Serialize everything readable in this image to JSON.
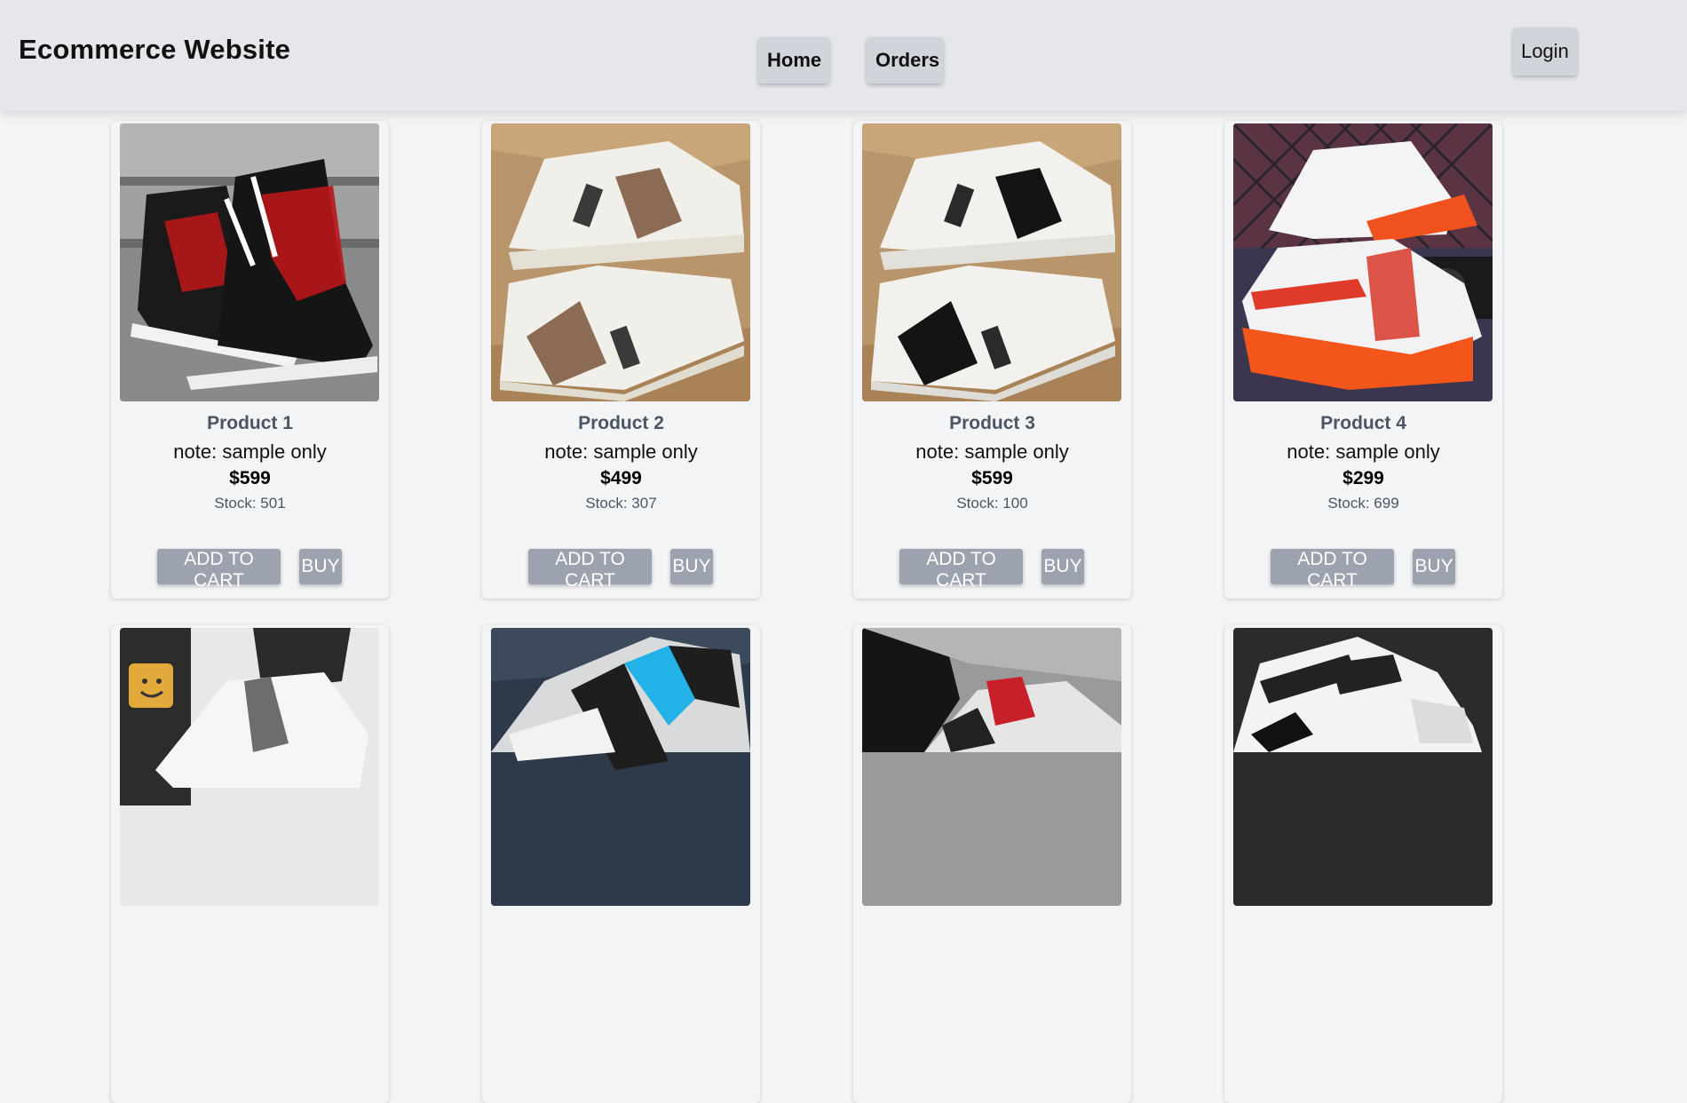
{
  "header": {
    "site_title": "Ecommerce Website",
    "nav": [
      {
        "label": "Home"
      },
      {
        "label": "Orders"
      }
    ],
    "login_label": "Login"
  },
  "products": [
    {
      "name": "Product 1",
      "note": "note: sample only",
      "price": "$599",
      "stock": "Stock: 501",
      "add_to_cart": "ADD TO CART",
      "buy": "BUY",
      "image": "black-red-hightop-sneakers"
    },
    {
      "name": "Product 2",
      "note": "note: sample only",
      "price": "$499",
      "stock": "Stock: 307",
      "add_to_cart": "ADD TO CART",
      "buy": "BUY",
      "image": "white-brown-sneakers-in-box"
    },
    {
      "name": "Product 3",
      "note": "note: sample only",
      "price": "$599",
      "stock": "Stock: 100",
      "add_to_cart": "ADD TO CART",
      "buy": "BUY",
      "image": "white-black-sneakers-in-box"
    },
    {
      "name": "Product 4",
      "note": "note: sample only",
      "price": "$299",
      "stock": "Stock: 699",
      "add_to_cart": "ADD TO CART",
      "buy": "BUY",
      "image": "white-orange-chunky-sneakers"
    },
    {
      "image": "white-sneaker-smiley"
    },
    {
      "image": "grey-blue-sneaker"
    },
    {
      "image": "grey-red-sneaker-worn"
    },
    {
      "image": "white-sport-sneaker"
    }
  ],
  "colors": {
    "header_bg": "#e5e7eb",
    "page_bg": "#f3f4f6",
    "button_bg": "#9ca3af",
    "nav_button_bg": "#d1d5db",
    "product_name": "#4b5563"
  }
}
